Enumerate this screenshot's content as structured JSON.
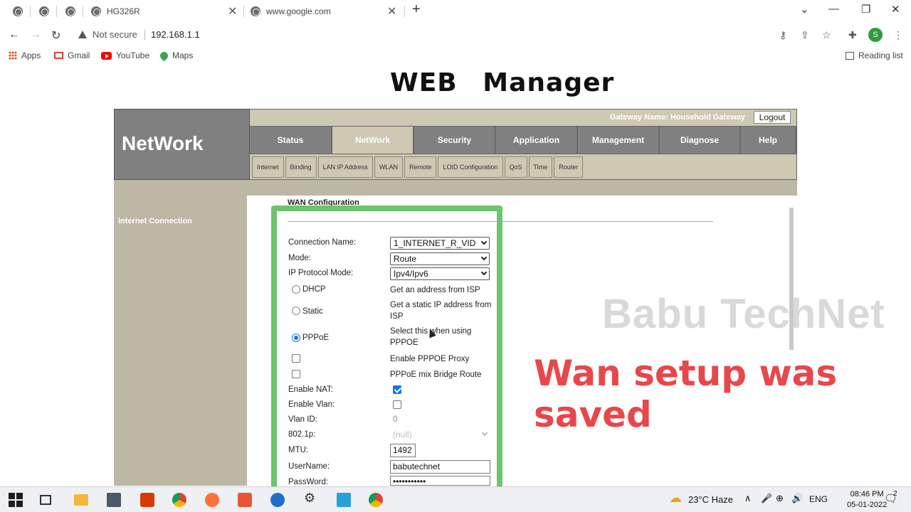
{
  "browser": {
    "tabs": [
      {
        "title": "HG326R"
      },
      {
        "title": "www.google.com"
      }
    ],
    "address": {
      "security": "Not secure",
      "url": "192.168.1.1"
    },
    "profile_initial": "S",
    "bookmarks": [
      "Apps",
      "Gmail",
      "YouTube",
      "Maps"
    ],
    "reading_list": "Reading list"
  },
  "page": {
    "title": "WEB Manager",
    "brand": "NetWork",
    "gateway_name": "Gateway Name: Household Gateway",
    "logout": "Logout",
    "main_nav": [
      "Status",
      "NetWork",
      "Security",
      "Application",
      "Management",
      "Diagnose",
      "Help"
    ],
    "active_main_nav": "NetWork",
    "sub_nav": [
      "Internet",
      "Binding",
      "LAN IP Address",
      "WLAN",
      "Remote",
      "LOID Configuration",
      "QoS",
      "Time",
      "Router"
    ],
    "sidebar_item": "Internet Connection",
    "panel_title": "WAN Configuration"
  },
  "form": {
    "connection_name_label": "Connection Name:",
    "connection_name": "1_INTERNET_R_VID",
    "mode_label": "Mode:",
    "mode": "Route",
    "ip_protocol_label": "IP Protocol Mode:",
    "ip_protocol": "Ipv4/Ipv6",
    "dhcp_label": "DHCP",
    "dhcp_desc": "Get an address from ISP",
    "static_label": "Static",
    "static_desc": "Get a static IP address from ISP",
    "pppoe_label": "PPPoE",
    "pppoe_desc": "Select this when using PPPOE",
    "pppoe_proxy_label": "Enable PPPOE Proxy",
    "pppoe_bridge_label": "PPPoE mix Bridge Route",
    "nat_label": "Enable NAT:",
    "vlan_label": "Enable Vlan:",
    "vlan_id_label": "Vlan ID:",
    "vlan_id": "0",
    "dot1p_label": "802.1p:",
    "dot1p": "(null)",
    "mtu_label": "MTU:",
    "mtu": "1492",
    "username_label": "UserName:",
    "username": "babutechnet",
    "password_label": "PassWord:",
    "password": "•••••••••••"
  },
  "overlay": {
    "watermark": "Babu TechNet",
    "caption": "Wan setup was saved",
    "caption_color": "#e8474b",
    "highlight_color": "#6cc46c"
  },
  "taskbar": {
    "weather": "23°C  Haze",
    "language": "ENG",
    "time": "08:46 PM",
    "date": "05-01-2022",
    "notifications": "2"
  }
}
